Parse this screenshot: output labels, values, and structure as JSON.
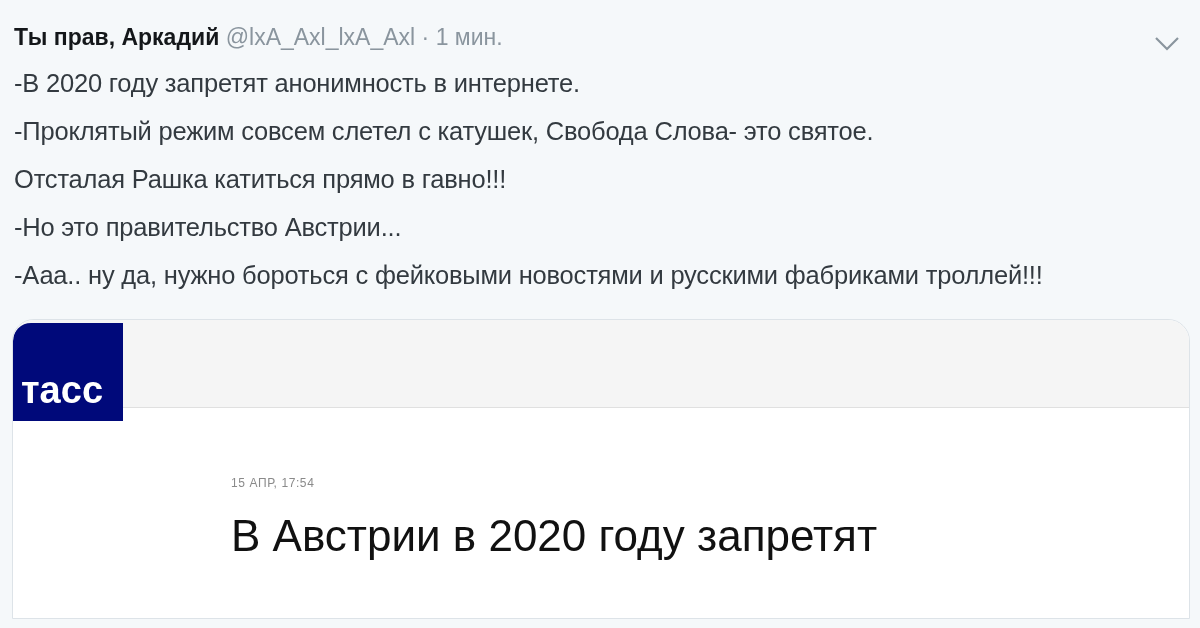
{
  "tweet": {
    "author": "Ты прав, Аркадий",
    "handle": "@lxA_Axl_lxA_Axl",
    "time": "· 1 мин.",
    "lines": [
      "-В 2020 году запретят анонимность в интернете.",
      "-Проклятый режим совсем слетел с катушек, Свобода Слова- это святое.",
      "Отсталая Рашка катиться прямо в гавно!!!",
      "-Но это правительство Австрии...",
      "-Ааа.. ну да, нужно бороться с фейковыми новостями и русскими фабриками троллей!!!"
    ]
  },
  "card": {
    "logo": "тасс",
    "date": "15 АПР, 17:54",
    "headline": "В Австрии в 2020 году запретят"
  }
}
